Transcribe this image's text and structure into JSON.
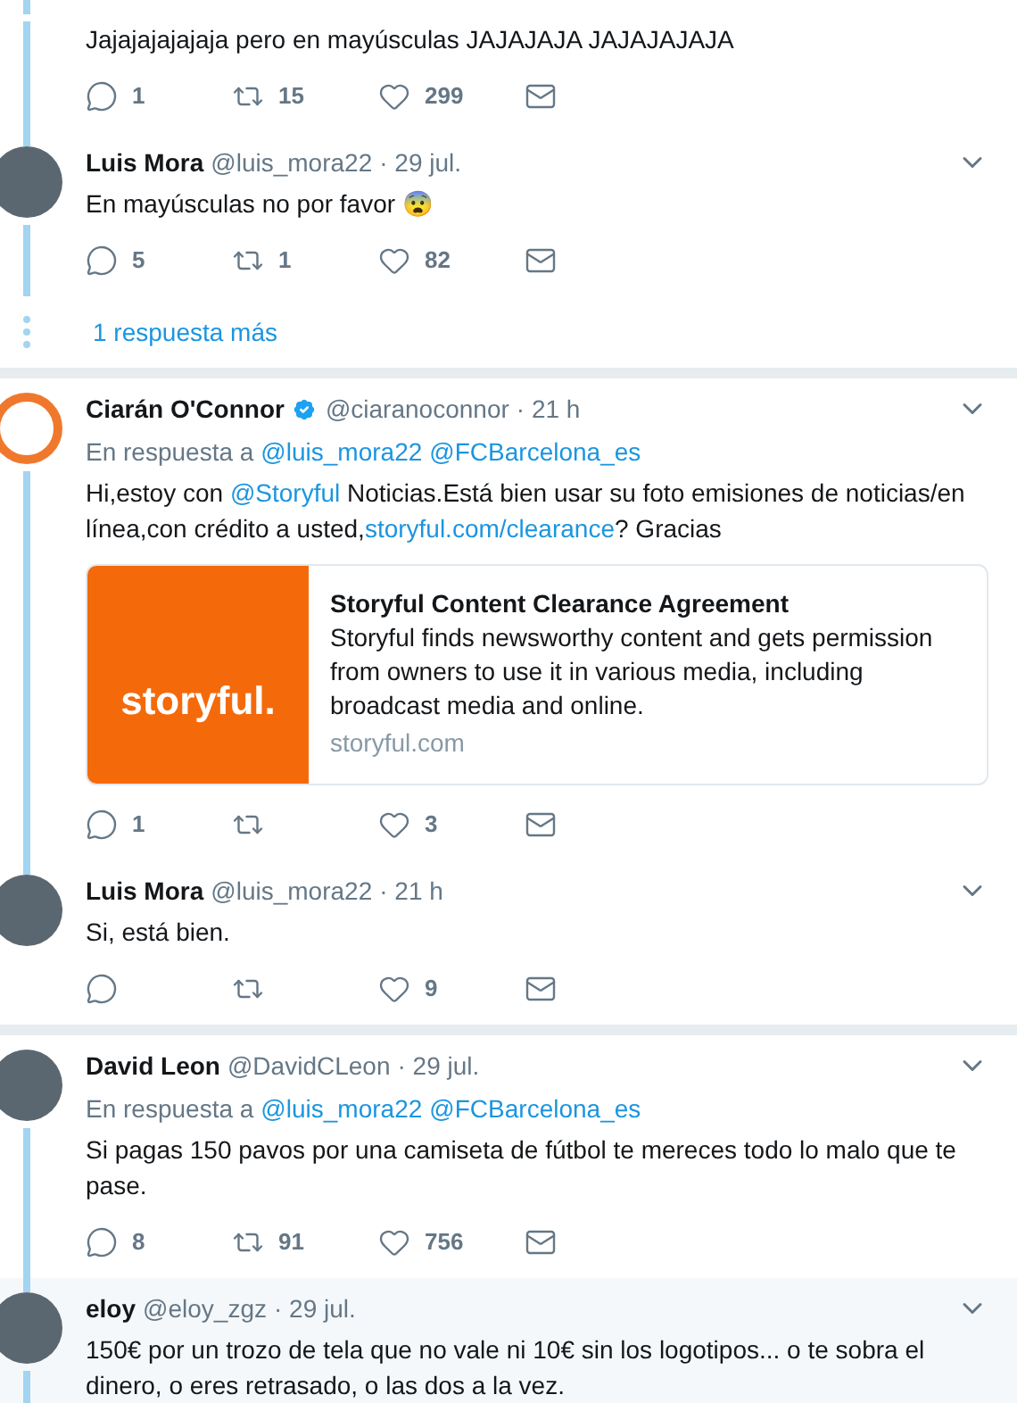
{
  "items": [
    {
      "kind": "tweet",
      "thread_above": true,
      "thread_below": true,
      "highlighted": false,
      "divider_after": false,
      "text": [
        {
          "kind": "plain",
          "text": "Jajajajajajaja pero en mayúsculas JAJAJAJA JAJAJAJAJA"
        }
      ],
      "actions": {
        "replies": "1",
        "retweets": "15",
        "likes": "299"
      }
    },
    {
      "kind": "tweet",
      "avatar": {
        "kind": "photo"
      },
      "thread_above": true,
      "thread_below": true,
      "highlighted": false,
      "divider_after": false,
      "name": "Luis Mora",
      "verified": false,
      "handle": "@luis_mora22",
      "time": "· 29 jul.",
      "text": [
        {
          "kind": "plain",
          "text": "En mayúsculas no por favor 😨"
        }
      ],
      "actions": {
        "replies": "5",
        "retweets": "1",
        "likes": "82"
      }
    },
    {
      "kind": "more",
      "label": "1 respuesta más",
      "divider_after": true
    },
    {
      "kind": "tweet",
      "avatar": {
        "kind": "outline"
      },
      "thread_above": false,
      "thread_below": true,
      "highlighted": false,
      "divider_after": false,
      "name": "Ciarán O'Connor",
      "verified": true,
      "handle": "@ciaranoconnor",
      "time": "· 21 h",
      "reply_prefix": "En respuesta a",
      "reply_to": [
        "@luis_mora22",
        "@FCBarcelona_es"
      ],
      "text": [
        {
          "kind": "plain",
          "text": "Hi,estoy con "
        },
        {
          "kind": "link",
          "text": "@Storyful"
        },
        {
          "kind": "plain",
          "text": " Noticias.Está bien usar su foto emisiones de noticias/en línea,con crédito a usted,"
        },
        {
          "kind": "link",
          "text": "storyful.com/clearance"
        },
        {
          "kind": "plain",
          "text": "? Gracias"
        }
      ],
      "card": {
        "logo": "storyful.",
        "title": "Storyful Content Clearance Agreement",
        "description": "Storyful finds newsworthy content and gets permission from owners to use it in various media, including broadcast media and online.",
        "domain": "storyful.com"
      },
      "actions": {
        "replies": "1",
        "likes": "3"
      }
    },
    {
      "kind": "tweet",
      "avatar": {
        "kind": "photo"
      },
      "thread_above": true,
      "thread_below": false,
      "highlighted": false,
      "divider_after": true,
      "name": "Luis Mora",
      "verified": false,
      "handle": "@luis_mora22",
      "time": "· 21 h",
      "text": [
        {
          "kind": "plain",
          "text": "Si, está bien."
        }
      ],
      "actions": {
        "likes": "9"
      }
    },
    {
      "kind": "tweet",
      "avatar": {
        "kind": "photo"
      },
      "thread_above": false,
      "thread_below": true,
      "highlighted": false,
      "divider_after": false,
      "name": "David Leon",
      "verified": false,
      "handle": "@DavidCLeon",
      "time": "· 29 jul.",
      "reply_prefix": "En respuesta a",
      "reply_to": [
        "@luis_mora22",
        "@FCBarcelona_es"
      ],
      "text": [
        {
          "kind": "plain",
          "text": "Si pagas 150 pavos por una camiseta de fútbol te mereces todo lo malo que te pase."
        }
      ],
      "actions": {
        "replies": "8",
        "retweets": "91",
        "likes": "756"
      }
    },
    {
      "kind": "tweet",
      "avatar": {
        "kind": "photo"
      },
      "thread_above": true,
      "thread_below": true,
      "highlighted": true,
      "divider_after": false,
      "name": "eloy",
      "verified": false,
      "handle": "@eloy_zgz",
      "time": "· 29 jul.",
      "text": [
        {
          "kind": "plain",
          "text": "150€ por un trozo de tela que no vale ni 10€ sin los logotipos... o te sobra el dinero, o eres retrasado, o las dos a la vez."
        }
      ]
    }
  ]
}
